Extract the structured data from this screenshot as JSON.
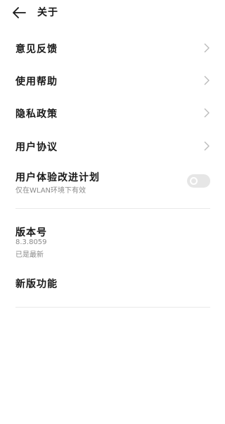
{
  "header": {
    "title": "关于",
    "back_icon": "arrow-left-icon"
  },
  "menu": [
    {
      "label": "意见反馈",
      "icon": "chevron-right-icon"
    },
    {
      "label": "使用帮助",
      "icon": "chevron-right-icon"
    },
    {
      "label": "隐私政策",
      "icon": "chevron-right-icon"
    },
    {
      "label": "用户协议",
      "icon": "chevron-right-icon"
    }
  ],
  "experience": {
    "label": "用户体验改进计划",
    "sublabel": "仅在WLAN环境下有效",
    "enabled": false
  },
  "version": {
    "title": "版本号",
    "number": "8.3.8059",
    "status": "已是最新"
  },
  "features": {
    "label": "新版功能"
  },
  "colors": {
    "switch_off": "#e6e6e6",
    "secondary_text": "#8a8a8a",
    "chevron": "#b8b8b8"
  }
}
